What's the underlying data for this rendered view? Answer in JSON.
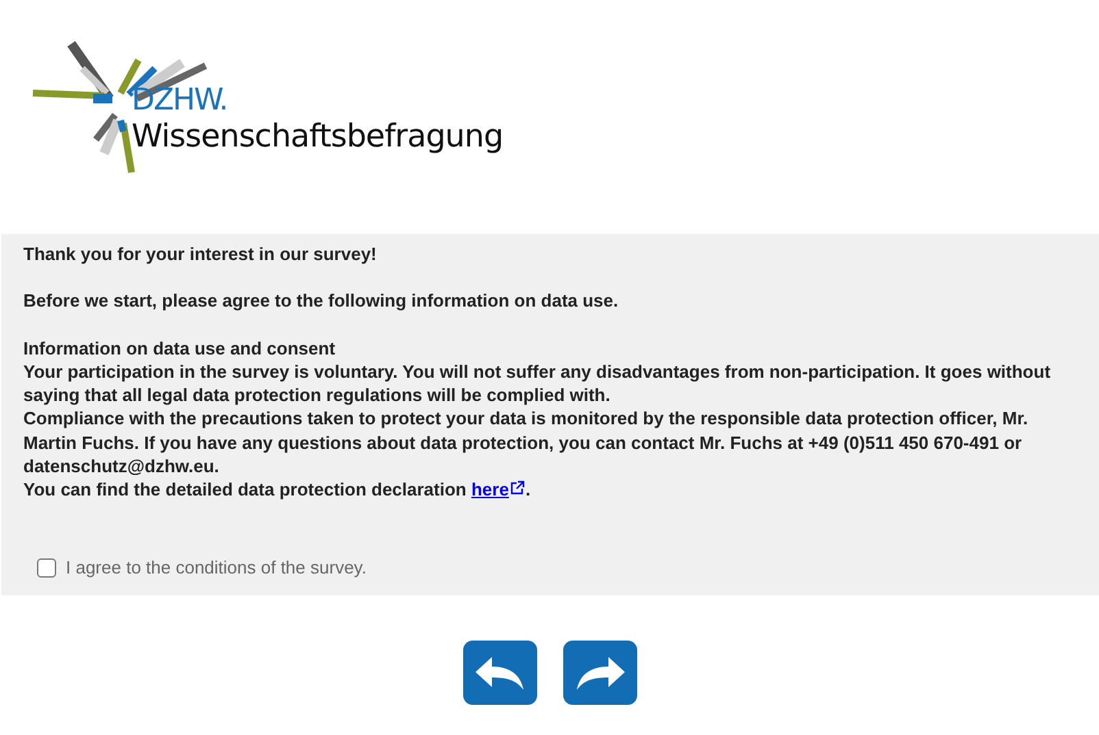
{
  "logo": {
    "acronym": "DZHW.",
    "name": "Wissenschaftsbefragung"
  },
  "intro": {
    "greeting": "Thank you for your interest in our survey!",
    "request": "Before we start, please agree to the following information on data use."
  },
  "consent": {
    "heading": "Information on data use and consent",
    "paragraphs": [
      "Your participation in the survey is voluntary. You will not suffer any disadvantages from non-participation. It goes without saying that all legal data protection regulations will be complied with.",
      "Compliance with the precautions taken to protect your data is monitored by the responsible data protection officer, Mr. Martin Fuchs. If you have any questions about data protection, you can contact Mr. Fuchs at +49 (0)511 450 670-491 or datenschutz@dzhw.eu."
    ],
    "declaration": {
      "before": "You can find the detailed data protection declaration ",
      "link": "here",
      "after": "."
    }
  },
  "agree": {
    "label": "I agree to the conditions of the survey.",
    "checked": false
  },
  "nav": [
    {
      "kind": "back"
    },
    {
      "kind": "forward"
    }
  ]
}
